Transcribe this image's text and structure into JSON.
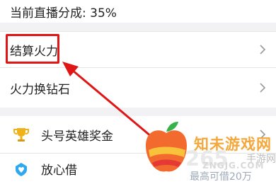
{
  "header": {
    "share_text": "当前直播分成: 35%"
  },
  "menu": {
    "settle": {
      "label": "结算火力"
    },
    "convert": {
      "label": "火力换钻石"
    },
    "hero": {
      "label": "头号英雄奖金",
      "icon": "trophy-icon"
    },
    "loan": {
      "label": "放心借",
      "icon": "heart-shield-icon"
    }
  },
  "annotation": {
    "box_color": "#e01515",
    "arrow_color": "#e01515"
  },
  "watermark": {
    "title": "知未游戏网",
    "number": "265",
    "sub": "手游网",
    "site": "ZNGJG.COM",
    "quota": "最高可借20万"
  }
}
